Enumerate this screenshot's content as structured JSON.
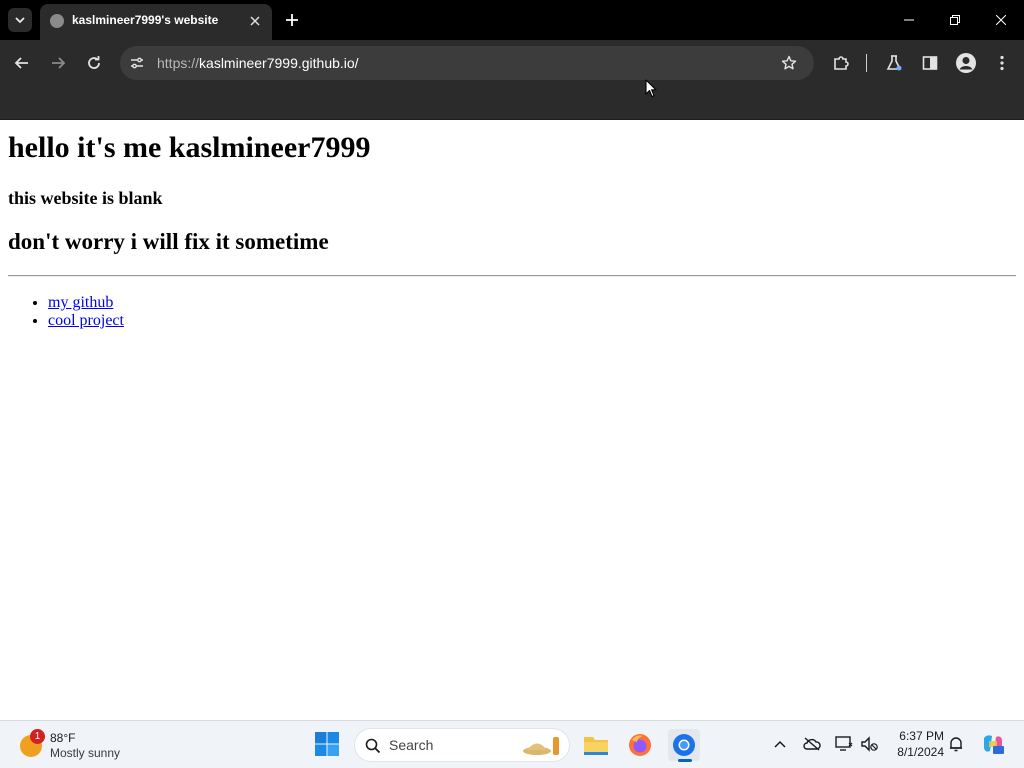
{
  "browser": {
    "tab": {
      "title": "kaslmineer7999's website",
      "close_label": "✕"
    },
    "new_tab_label": "+",
    "address": {
      "scheme": "https://",
      "host_path": "kaslmineer7999.github.io/"
    },
    "window_controls": {
      "minimize": "—",
      "maximize": "❐",
      "close": "✕"
    }
  },
  "page": {
    "heading": "hello it's me kaslmineer7999",
    "subheading": "this website is blank",
    "note": "don't worry i will fix it sometime",
    "links": [
      {
        "label": "my github"
      },
      {
        "label": "cool project"
      }
    ]
  },
  "taskbar": {
    "weather": {
      "badge": "1",
      "temperature": "88°F",
      "condition": "Mostly sunny"
    },
    "search_label": "Search",
    "clock": {
      "time": "6:37 PM",
      "date": "8/1/2024"
    }
  },
  "colors": {
    "chrome_dark": "#2b2b2b",
    "tabstrip": "#000000",
    "link": "#0000ee",
    "taskbar": "#f0f3f8",
    "accent": "#0067c0"
  }
}
